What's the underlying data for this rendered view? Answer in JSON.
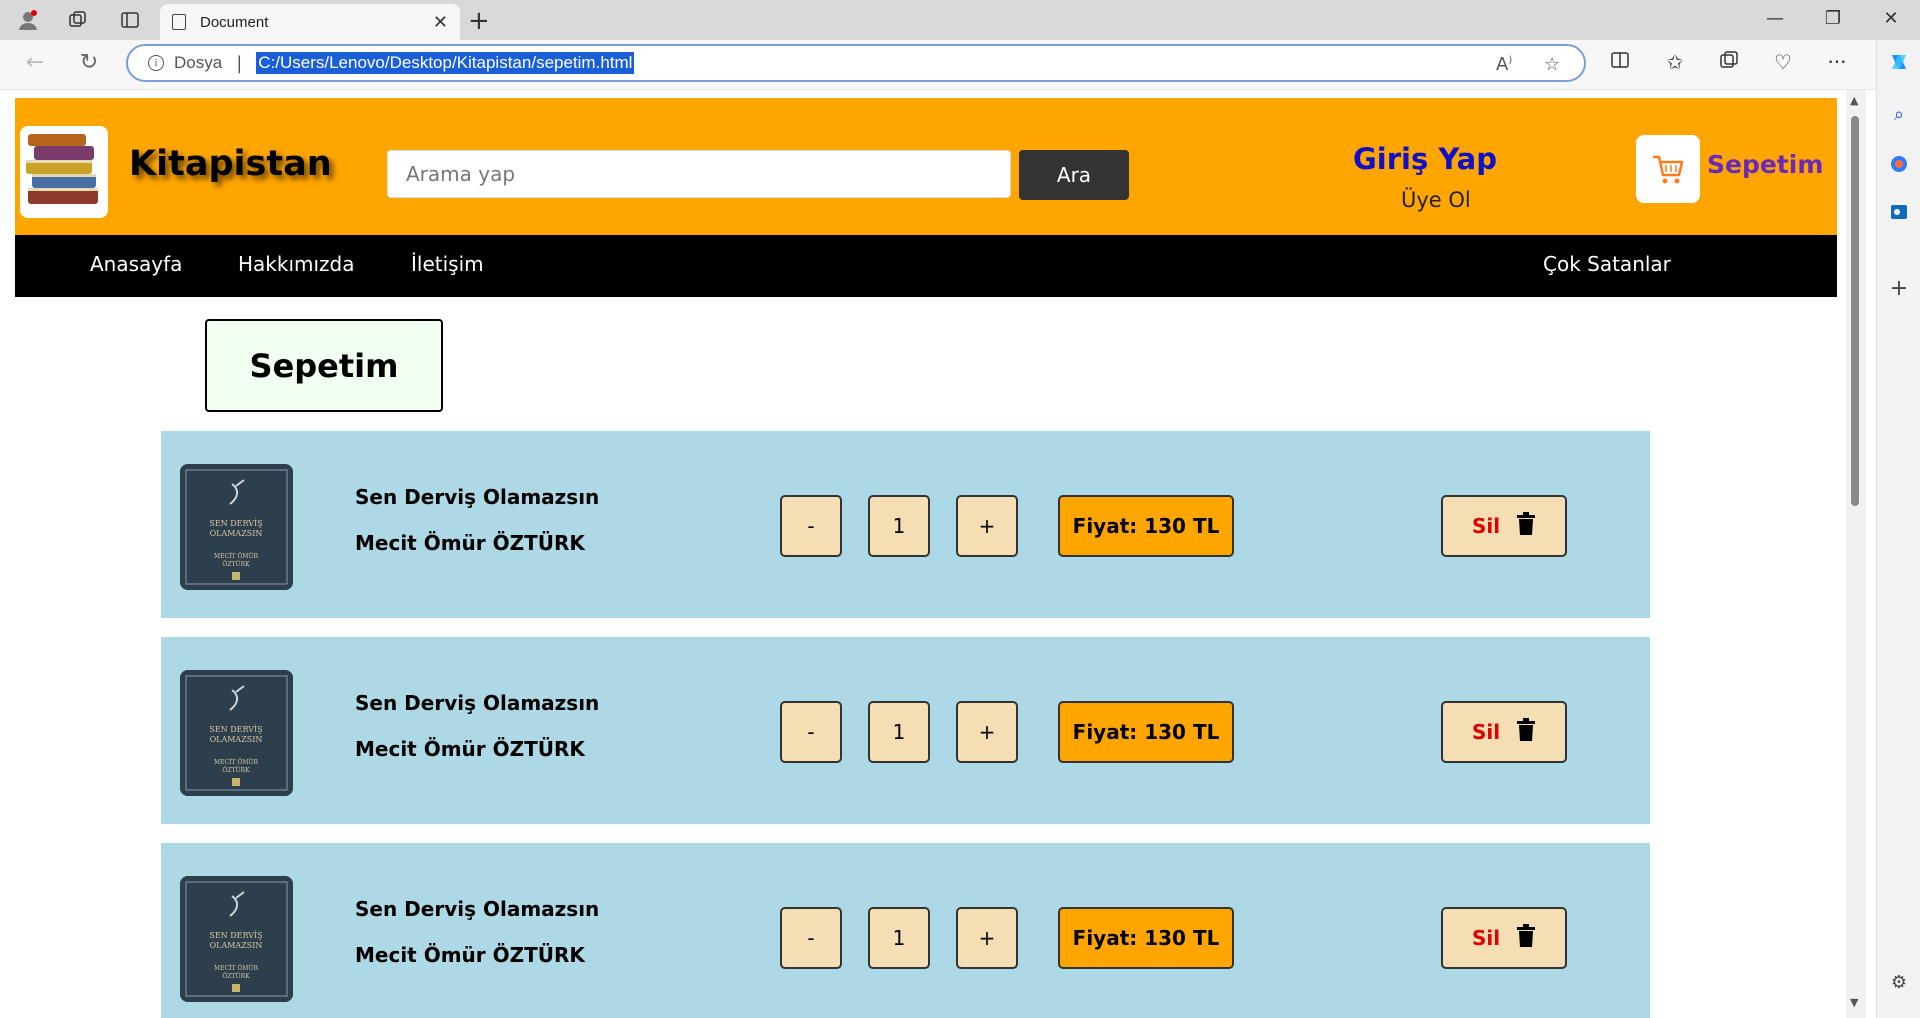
{
  "browser": {
    "tab_title": "Document",
    "url_scheme_label": "Dosya",
    "url": "C:/Users/Lenovo/Desktop/Kitapistan/sepetim.html"
  },
  "header": {
    "brand": "Kitapistan",
    "search_placeholder": "Arama yap",
    "search_button": "Ara",
    "login": "Giriş Yap",
    "signup": "Üye Ol",
    "cart": "Sepetim"
  },
  "nav": {
    "items": [
      "Anasayfa",
      "Hakkımızda",
      "İletişim"
    ],
    "right_item": "Çok Satanlar"
  },
  "page": {
    "title": "Sepetim"
  },
  "cart_items": [
    {
      "title": "Sen Derviş Olamazsın",
      "author": "Mecit Ömür ÖZTÜRK",
      "quantity": "1",
      "price": "Fiyat: 130 TL",
      "decrement": "-",
      "increment": "+",
      "delete": "Sil",
      "cover_text": "SEN DERVİŞ OLAMAZSIN"
    },
    {
      "title": "Sen Derviş Olamazsın",
      "author": "Mecit Ömür ÖZTÜRK",
      "quantity": "1",
      "price": "Fiyat: 130 TL",
      "decrement": "-",
      "increment": "+",
      "delete": "Sil",
      "cover_text": "SEN DERVİŞ OLAMAZSIN"
    },
    {
      "title": "Sen Derviş Olamazsın",
      "author": "Mecit Ömür ÖZTÜRK",
      "quantity": "1",
      "price": "Fiyat: 130 TL",
      "decrement": "-",
      "increment": "+",
      "delete": "Sil",
      "cover_text": "SEN DERVİŞ OLAMAZSIN"
    }
  ],
  "colors": {
    "header_bg": "#ffa500",
    "nav_bg": "#000000",
    "row_bg": "#add8e6",
    "button_bg": "#f5deb3",
    "login_color": "#1010c8",
    "cart_color": "#6a2ab8",
    "delete_color": "#e00000"
  }
}
